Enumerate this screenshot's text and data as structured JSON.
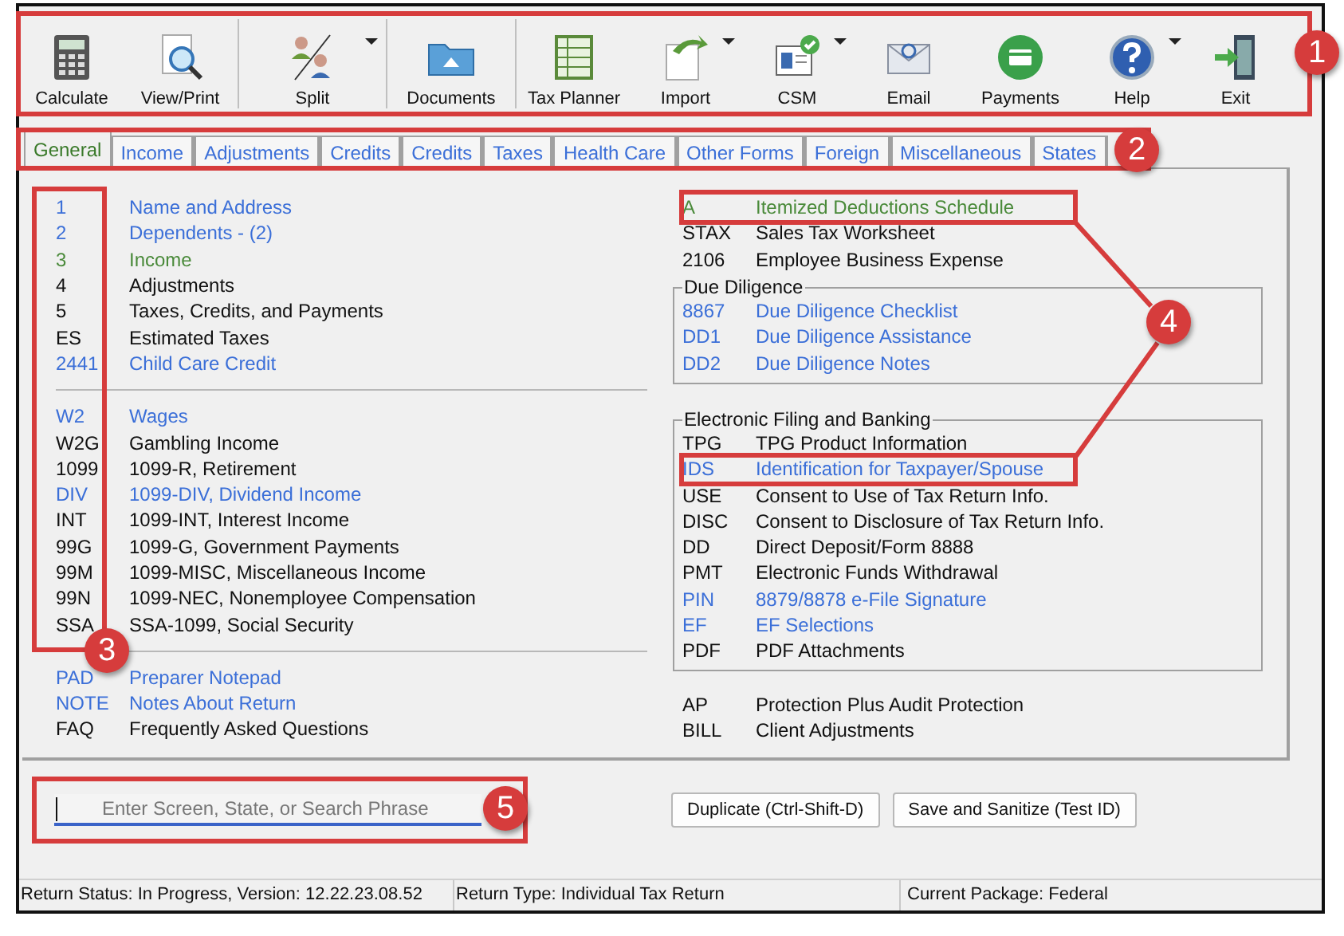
{
  "toolbar": {
    "groups": [
      [
        {
          "label": "Calculate",
          "dropdown": false
        },
        {
          "label": "View/Print",
          "dropdown": false
        }
      ],
      [
        {
          "label": "Split",
          "dropdown": true
        }
      ],
      [
        {
          "label": "Documents",
          "dropdown": false
        }
      ],
      [
        {
          "label": "Tax Planner",
          "dropdown": false
        },
        {
          "label": "Import",
          "dropdown": true
        },
        {
          "label": "CSM",
          "dropdown": true
        },
        {
          "label": "Email",
          "dropdown": false
        },
        {
          "label": "Payments",
          "dropdown": false
        },
        {
          "label": "Help",
          "dropdown": true
        },
        {
          "label": "Exit",
          "dropdown": false
        }
      ]
    ]
  },
  "tabs": [
    {
      "label": "General",
      "selected": true
    },
    {
      "label": "Income",
      "selected": false
    },
    {
      "label": "Adjustments",
      "selected": false
    },
    {
      "label": "Credits",
      "selected": false
    },
    {
      "label": "Credits",
      "selected": false
    },
    {
      "label": "Taxes",
      "selected": false
    },
    {
      "label": "Health Care",
      "selected": false
    },
    {
      "label": "Other Forms",
      "selected": false
    },
    {
      "label": "Foreign",
      "selected": false
    },
    {
      "label": "Miscellaneous",
      "selected": false
    },
    {
      "label": "States",
      "selected": false
    }
  ],
  "left_sections": [
    [
      {
        "code": "1",
        "title": "Name and Address",
        "kind": "link"
      },
      {
        "code": "2",
        "title": "Dependents - (2)",
        "kind": "link"
      },
      {
        "code": "3",
        "title": "Income",
        "kind": "visited"
      },
      {
        "code": "4",
        "title": "Adjustments",
        "kind": "plain"
      },
      {
        "code": "5",
        "title": "Taxes, Credits, and Payments",
        "kind": "plain"
      },
      {
        "code": "ES",
        "title": "Estimated Taxes",
        "kind": "plain"
      },
      {
        "code": "2441",
        "title": "Child Care Credit",
        "kind": "link"
      }
    ],
    [
      {
        "code": "W2",
        "title": "Wages",
        "kind": "link"
      },
      {
        "code": "W2G",
        "title": "Gambling Income",
        "kind": "plain"
      },
      {
        "code": "1099",
        "title": "1099-R, Retirement",
        "kind": "plain"
      },
      {
        "code": "DIV",
        "title": "1099-DIV, Dividend Income",
        "kind": "link"
      },
      {
        "code": "INT",
        "title": "1099-INT, Interest Income",
        "kind": "plain"
      },
      {
        "code": "99G",
        "title": "1099-G, Government Payments",
        "kind": "plain"
      },
      {
        "code": "99M",
        "title": "1099-MISC, Miscellaneous Income",
        "kind": "plain"
      },
      {
        "code": "99N",
        "title": "1099-NEC, Nonemployee Compensation",
        "kind": "plain"
      },
      {
        "code": "SSA",
        "title": "SSA-1099, Social Security",
        "kind": "plain"
      }
    ],
    [
      {
        "code": "PAD",
        "title": "Preparer Notepad",
        "kind": "link"
      },
      {
        "code": "NOTE",
        "title": "Notes About Return",
        "kind": "link"
      },
      {
        "code": "FAQ",
        "title": "Frequently Asked Questions",
        "kind": "plain"
      }
    ]
  ],
  "right_top": [
    {
      "code": "A",
      "title": "Itemized Deductions Schedule",
      "kind": "visited"
    },
    {
      "code": "STAX",
      "title": "Sales Tax Worksheet",
      "kind": "plain"
    },
    {
      "code": "2106",
      "title": "Employee Business Expense",
      "kind": "plain"
    }
  ],
  "due_diligence": {
    "title": "Due Diligence",
    "rows": [
      {
        "code": "8867",
        "title": "Due Diligence Checklist",
        "kind": "link"
      },
      {
        "code": "DD1",
        "title": "Due Diligence Assistance",
        "kind": "link"
      },
      {
        "code": "DD2",
        "title": "Due Diligence Notes",
        "kind": "link"
      }
    ]
  },
  "electronic_filing": {
    "title": "Electronic Filing and Banking",
    "rows": [
      {
        "code": "TPG",
        "title": "TPG Product Information",
        "kind": "plain"
      },
      {
        "code": "IDS",
        "title": "Identification for Taxpayer/Spouse",
        "kind": "link"
      },
      {
        "code": "USE",
        "title": "Consent to Use of Tax Return Info.",
        "kind": "plain"
      },
      {
        "code": "DISC",
        "title": "Consent to Disclosure of Tax Return Info.",
        "kind": "plain"
      },
      {
        "code": "DD",
        "title": "Direct Deposit/Form 8888",
        "kind": "plain"
      },
      {
        "code": "PMT",
        "title": "Electronic Funds Withdrawal",
        "kind": "plain"
      },
      {
        "code": "PIN",
        "title": "8879/8878 e-File Signature",
        "kind": "link"
      },
      {
        "code": "EF",
        "title": "EF Selections",
        "kind": "link"
      },
      {
        "code": "PDF",
        "title": "PDF Attachments",
        "kind": "plain"
      }
    ]
  },
  "right_bottom": [
    {
      "code": "AP",
      "title": "Protection Plus Audit Protection",
      "kind": "plain"
    },
    {
      "code": "BILL",
      "title": "Client Adjustments",
      "kind": "plain"
    }
  ],
  "search": {
    "placeholder": "Enter Screen, State, or Search Phrase"
  },
  "buttons": [
    "Duplicate (Ctrl-Shift-D)",
    "Save and Sanitize (Test ID)"
  ],
  "status_bar": [
    "Return Status: In Progress, Version: 12.22.23.08.52",
    "Return Type: Individual Tax Return",
    "Current Package: Federal"
  ],
  "annotations": [
    {
      "number": "1"
    },
    {
      "number": "2"
    },
    {
      "number": "3"
    },
    {
      "number": "4"
    },
    {
      "number": "5"
    }
  ]
}
